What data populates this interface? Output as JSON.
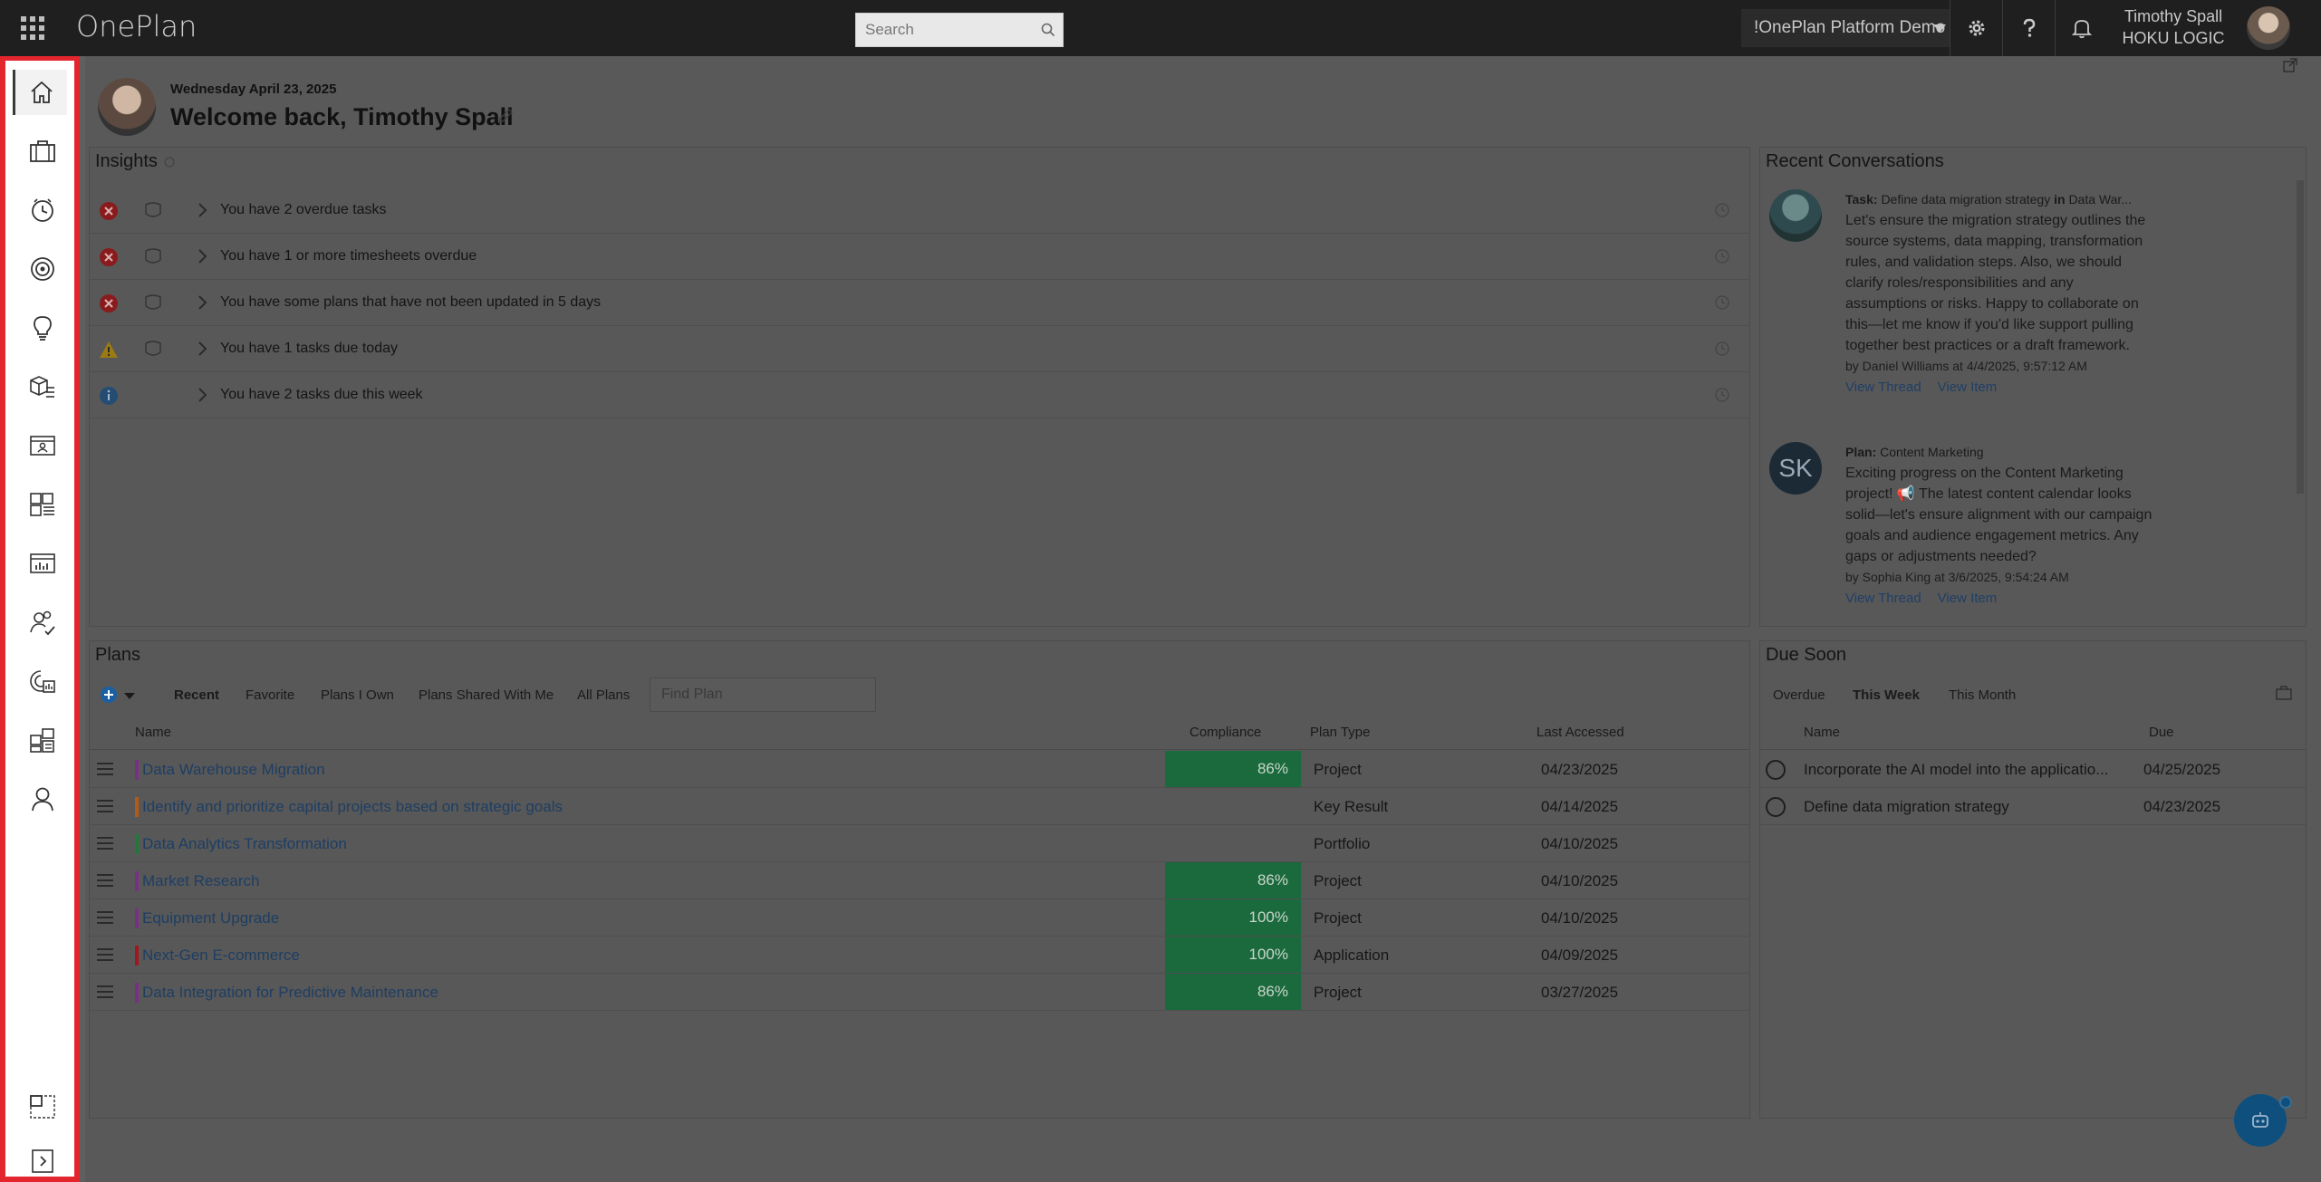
{
  "app": {
    "brand": "OnePlan"
  },
  "topbar": {
    "search_placeholder": "Search",
    "tenant": "!OnePlan Platform Demo",
    "user_name": "Timothy Spall",
    "user_org": "HOKU LOGIC"
  },
  "leftnav": {
    "items": [
      {
        "icon": "home-icon"
      },
      {
        "icon": "briefcase-icon"
      },
      {
        "icon": "timesheet-clock-icon"
      },
      {
        "icon": "target-icon"
      },
      {
        "icon": "lightbulb-icon"
      },
      {
        "icon": "products-icon"
      },
      {
        "icon": "resource-card-icon"
      },
      {
        "icon": "dashboard-list-icon"
      },
      {
        "icon": "report-chart-icon"
      },
      {
        "icon": "people-check-icon"
      },
      {
        "icon": "portfolio-report-icon"
      },
      {
        "icon": "hierarchy-icon"
      },
      {
        "icon": "user-icon"
      }
    ],
    "bottom_items": [
      {
        "icon": "layout-select-icon"
      },
      {
        "icon": "expand-nav-icon"
      }
    ]
  },
  "header": {
    "date": "Wednesday April 23, 2025",
    "welcome": "Welcome back, Timothy Spall"
  },
  "insights": {
    "title": "Insights",
    "rows": [
      {
        "status": "error",
        "text": "You have 2 overdue tasks",
        "badge": true
      },
      {
        "status": "error",
        "text": "You have 1 or more timesheets overdue",
        "badge": true
      },
      {
        "status": "error",
        "text": "You have some plans that have not been updated in 5 days",
        "badge": true
      },
      {
        "status": "warning",
        "text": "You have 1 tasks due today",
        "badge": true
      },
      {
        "status": "info",
        "text": "You have 2 tasks due this week",
        "badge": false
      }
    ]
  },
  "conversations": {
    "title": "Recent Conversations",
    "items": [
      {
        "type_label": "Task:",
        "subject": "Define data migration strategy",
        "in_label": "in",
        "location": "Data War...",
        "body": "Let's ensure the migration strategy outlines the source systems, data mapping, transformation rules, and validation steps. Also, we should clarify roles/responsibilities and any assumptions or risks. Happy to collaborate on this—let me know if you'd like support pulling together best practices or a draft framework.",
        "by": "by Daniel Williams at 4/4/2025, 9:57:12 AM",
        "view_thread": "View Thread",
        "view_item": "View Item",
        "avatar_initials": ""
      },
      {
        "type_label": "Plan:",
        "subject": "Content Marketing",
        "in_label": "",
        "location": "",
        "body": "Exciting progress on the Content Marketing project! 📢 The latest content calendar looks solid—let's ensure alignment with our campaign goals and audience engagement metrics. Any gaps or adjustments needed?",
        "by": "by Sophia King at 3/6/2025, 9:54:24 AM",
        "view_thread": "View Thread",
        "view_item": "View Item",
        "avatar_initials": "SK"
      }
    ]
  },
  "plans": {
    "title": "Plans",
    "tabs": [
      "Recent",
      "Favorite",
      "Plans I Own",
      "Plans Shared With Me",
      "All Plans"
    ],
    "active_tab": "Recent",
    "find_placeholder": "Find Plan",
    "columns": {
      "name": "Name",
      "compliance": "Compliance",
      "type": "Plan Type",
      "accessed": "Last Accessed"
    },
    "rows": [
      {
        "name": "Data Warehouse Migration",
        "color": "#7a2f86",
        "compliance": "86%",
        "type": "Project",
        "accessed": "04/23/2025"
      },
      {
        "name": "Identify and prioritize capital projects based on strategic goals",
        "color": "#b35a1a",
        "compliance": "",
        "type": "Key Result",
        "accessed": "04/14/2025"
      },
      {
        "name": "Data Analytics Transformation",
        "color": "#1f7a3a",
        "compliance": "",
        "type": "Portfolio",
        "accessed": "04/10/2025"
      },
      {
        "name": "Market Research",
        "color": "#7a2f86",
        "compliance": "86%",
        "type": "Project",
        "accessed": "04/10/2025"
      },
      {
        "name": "Equipment Upgrade",
        "color": "#7a2f86",
        "compliance": "100%",
        "type": "Project",
        "accessed": "04/10/2025"
      },
      {
        "name": "Next-Gen E-commerce",
        "color": "#a3161d",
        "compliance": "100%",
        "type": "Application",
        "accessed": "04/09/2025"
      },
      {
        "name": "Data Integration for Predictive Maintenance",
        "color": "#7a2f86",
        "compliance": "86%",
        "type": "Project",
        "accessed": "03/27/2025"
      }
    ]
  },
  "due_soon": {
    "title": "Due Soon",
    "tabs": [
      "Overdue",
      "This Week",
      "This Month"
    ],
    "active_tab": "This Week",
    "columns": {
      "name": "Name",
      "due": "Due"
    },
    "rows": [
      {
        "name": "Incorporate the AI model into the applicatio...",
        "due": "04/25/2025"
      },
      {
        "name": "Define data migration strategy",
        "due": "04/23/2025"
      }
    ]
  },
  "colors": {
    "nav_highlight": "#e3262d",
    "compliance_green": "#1b6a3d",
    "link_blue": "#1e3e63"
  }
}
